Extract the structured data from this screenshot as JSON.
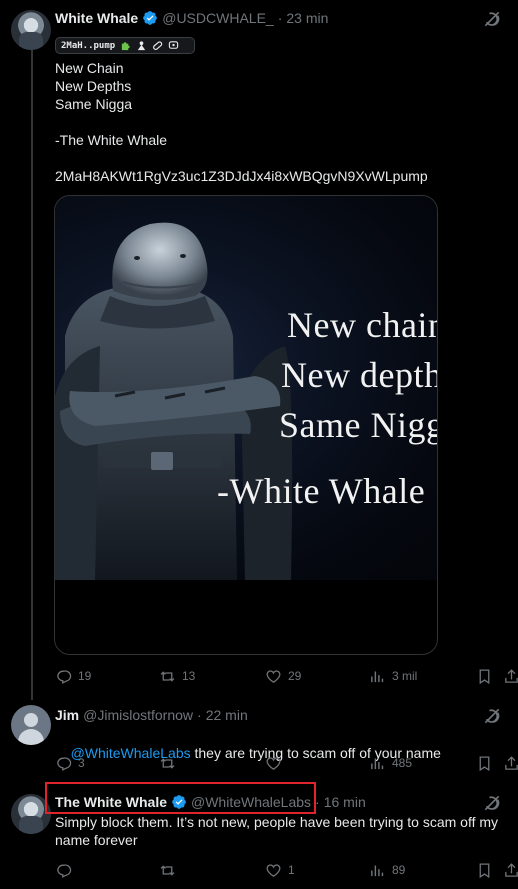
{
  "tweets": [
    {
      "name": "White Whale",
      "handle": "@USDCWHALE_",
      "separator": "·",
      "time": "23 min",
      "chip": {
        "label": "2MaH..pump"
      },
      "text": "New Chain\nNew Depths\nSame Nigga\n\n-The White Whale\n\n2MaH8AKWt1RgVz3uc1Z3DJdJx4i8xWBQgvN9XvWLpump",
      "media": {
        "line1": "New chain",
        "line2": "New depths",
        "line3": "Same Nigga",
        "line4": "-White Whale"
      },
      "stats": {
        "replies": "19",
        "reposts": "13",
        "likes": "29",
        "views": "3 mil"
      }
    },
    {
      "name": "Jim",
      "handle": "@Jimislostfornow",
      "separator": "·",
      "time": "22 min",
      "mention": "@WhiteWhaleLabs",
      "text": " they are trying to scam off of your name",
      "stats": {
        "replies": "3",
        "reposts": "",
        "likes": "",
        "views": "485"
      }
    },
    {
      "name": "The White Whale",
      "handle": "@WhiteWhaleLabs",
      "separator": "·",
      "time": "16 min",
      "text": "Simply block them. It’s not new, people have been trying to scam off my name forever",
      "stats": {
        "replies": "",
        "reposts": "",
        "likes": "1",
        "views": "89"
      }
    }
  ],
  "icons": {
    "verified": "verified-badge-icon",
    "grok": "grok-icon",
    "reply": "reply-icon",
    "repost": "repost-icon",
    "like": "like-icon",
    "views": "views-icon",
    "bookmark": "bookmark-icon",
    "share": "share-icon"
  },
  "colors": {
    "background": "#000000",
    "text": "#e7e9ea",
    "muted": "#71767b",
    "accent": "#1d9bf0",
    "highlight": "#e0242b"
  }
}
